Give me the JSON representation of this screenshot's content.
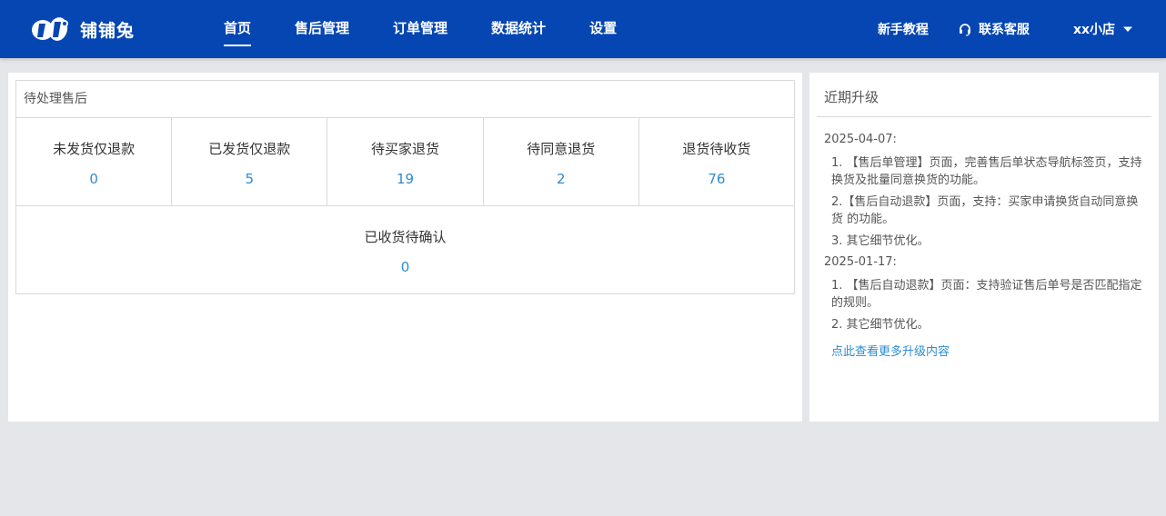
{
  "brand": {
    "name": "铺铺兔"
  },
  "nav": [
    {
      "label": "首页",
      "active": true
    },
    {
      "label": "售后管理",
      "active": false
    },
    {
      "label": "订单管理",
      "active": false
    },
    {
      "label": "数据统计",
      "active": false
    },
    {
      "label": "设置",
      "active": false
    }
  ],
  "header_links": {
    "tutorial": "新手教程",
    "support": "联系客服",
    "shop": "xx小店"
  },
  "pending": {
    "title": "待处理售后",
    "stats": [
      {
        "label": "未发货仅退款",
        "value": "0"
      },
      {
        "label": "已发货仅退款",
        "value": "5"
      },
      {
        "label": "待买家退货",
        "value": "19"
      },
      {
        "label": "待同意退货",
        "value": "2"
      },
      {
        "label": "退货待收货",
        "value": "76"
      }
    ],
    "extra": {
      "label": "已收货待确认",
      "value": "0"
    }
  },
  "upgrades": {
    "title": "近期升级",
    "entries": [
      {
        "date": "2025-04-07:",
        "items": [
          "1. 【售后单管理】页面，完善售后单状态导航标签页，支持换货及批量同意换货的功能。",
          "2.【售后自动退款】页面，支持：买家申请换货自动同意换货 的功能。",
          "3. 其它细节优化。"
        ]
      },
      {
        "date": "2025-01-17:",
        "items": [
          "1. 【售后自动退款】页面：支持验证售后单号是否匹配指定的规则。",
          "2. 其它细节优化。"
        ]
      }
    ],
    "more_link": "点此查看更多升级内容"
  },
  "colors": {
    "header_bg": "#0546b3",
    "link": "#2d8ccf",
    "page_bg": "#e5e6ea"
  }
}
